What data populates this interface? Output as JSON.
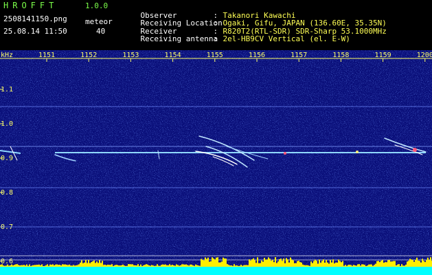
{
  "header": {
    "app_title": "HROFFT",
    "app_version": "1.0.0",
    "file_name": "2508141150.png",
    "timestamp": "25.08.14 11:50",
    "mode_label": "meteor",
    "mode_count": "40"
  },
  "info": [
    {
      "key": "Observer",
      "sep": ":",
      "value": "Takanori Kawachi"
    },
    {
      "key": "Receiving Location",
      "sep": ":",
      "value": "Ogaki, Gifu, JAPAN (136.60E, 35.35N)"
    },
    {
      "key": "Receiver",
      "sep": ":",
      "value": "R820T2(RTL-SDR) SDR-Sharp 53.1000MHz"
    },
    {
      "key": "Receiving antenna",
      "sep": ":",
      "value": "2el-HB9CV Vertical (el. E-W)"
    }
  ],
  "spectrogram": {
    "unit_label": "kHz",
    "time_ticks": [
      "1151",
      "1152",
      "1153",
      "1154",
      "1155",
      "1156",
      "1157",
      "1158",
      "1159",
      "1200"
    ],
    "freq_ticks": [
      "1.1",
      "1.0",
      "0.9",
      "0.8",
      "0.7",
      "0.6"
    ],
    "colors": {
      "background": "#0a0f7a",
      "noise": "#3a5cff",
      "carrier": "#8fd8ff",
      "echo": "#ffffff",
      "activity": "#ffee00",
      "baseline": "#00ffff",
      "axis": "#ffff66"
    }
  }
}
